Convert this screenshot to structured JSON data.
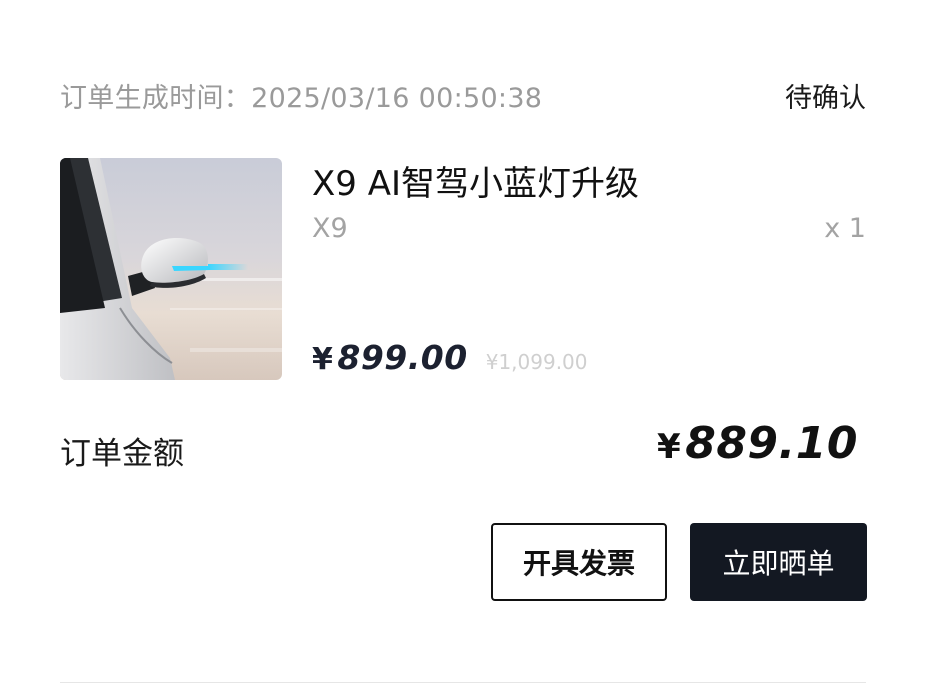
{
  "order": {
    "time_label": "订单生成时间：",
    "time_value": "2025/03/16 00:50:38",
    "status": "待确认"
  },
  "product": {
    "image_icon": "car-side-mirror-light-image",
    "title": "X9 AI智驾小蓝灯升级",
    "variant": "X9",
    "quantity": "x 1",
    "currency": "¥",
    "price": "899.00",
    "original_price": "¥1,099.00"
  },
  "total": {
    "label": "订单金额",
    "currency": "¥",
    "value": "889.10"
  },
  "actions": {
    "invoice_label": "开具发票",
    "share_label": "立即晒单"
  },
  "colors": {
    "primary_button": "#131822",
    "muted_text": "#9a9a9a",
    "accent_light": "#3ad6ff"
  }
}
